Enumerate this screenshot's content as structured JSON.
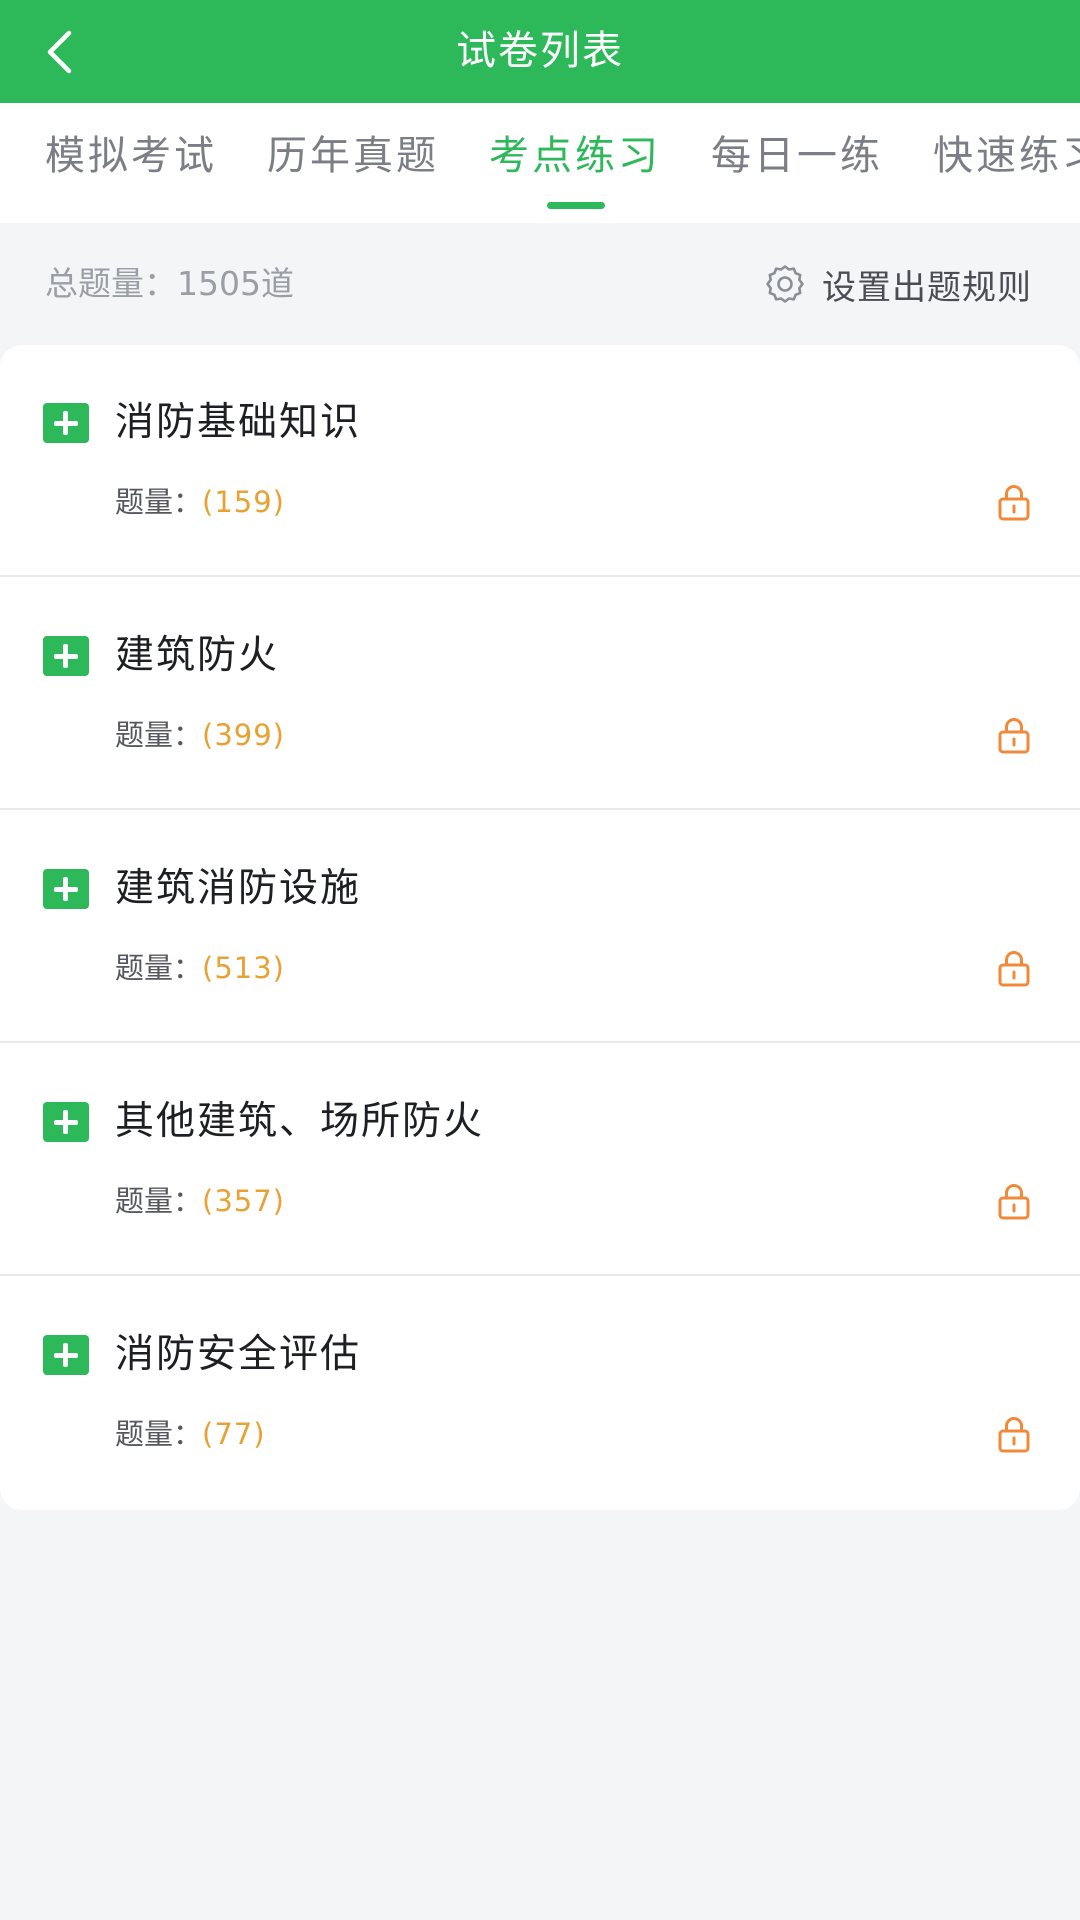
{
  "header": {
    "title": "试卷列表"
  },
  "tabs": [
    {
      "label": "模拟考试"
    },
    {
      "label": "历年真题"
    },
    {
      "label": "考点练习"
    },
    {
      "label": "每日一练"
    },
    {
      "label": "快速练习"
    }
  ],
  "active_tab_index": 2,
  "summary": {
    "total_text": "总题量：1505道",
    "rules_label": "设置出题规则"
  },
  "topics": [
    {
      "title": "消防基础知识",
      "count_label": "题量：",
      "count": "(159)"
    },
    {
      "title": "建筑防火",
      "count_label": "题量：",
      "count": "(399)"
    },
    {
      "title": "建筑消防设施",
      "count_label": "题量：",
      "count": "(513)"
    },
    {
      "title": "其他建筑、场所防火",
      "count_label": "题量：",
      "count": "(357)"
    },
    {
      "title": "消防安全评估",
      "count_label": "题量：",
      "count": "(77)"
    }
  ],
  "colors": {
    "primary": "#2db85a",
    "count_orange": "#e8a234",
    "lock_orange": "#f0893a"
  },
  "icons": {
    "back": "chevron-left-icon",
    "settings": "gear-icon",
    "expand": "plus-icon",
    "lock": "lock-icon"
  }
}
